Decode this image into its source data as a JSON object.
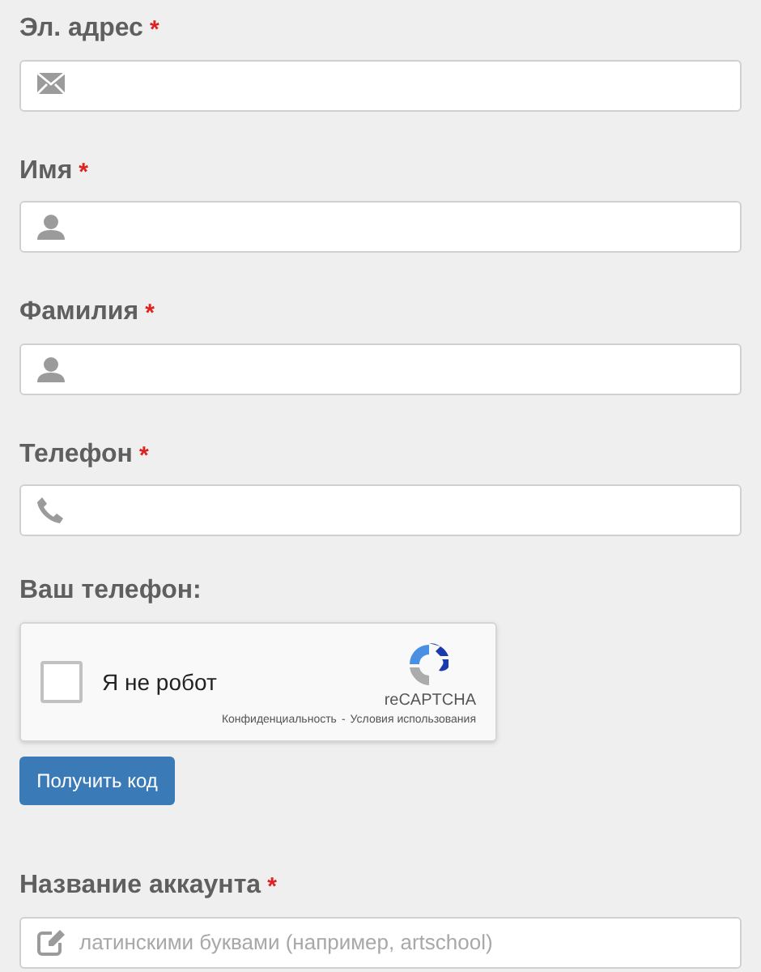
{
  "fields": [
    {
      "label": "Эл. адрес",
      "required_mark": "*",
      "kind": "mail"
    },
    {
      "label": "Имя",
      "required_mark": "*",
      "kind": "user"
    },
    {
      "label": "Фамилия",
      "required_mark": "*",
      "kind": "user"
    },
    {
      "label": "Телефон",
      "required_mark": "*",
      "kind": "phone"
    }
  ],
  "phone_section": {
    "label": "Ваш телефон:",
    "captcha": {
      "checked": false,
      "label": "Я не робот",
      "brand": "reCAPTCHA",
      "privacy": "Конфиденциальность",
      "separator": "-",
      "terms": "Условия использования"
    },
    "button": "Получить код"
  },
  "account_field": {
    "label": "Название аккаунта",
    "required_mark": "*",
    "kind": "edit",
    "placeholder": "латинскими буквами (например, artschool)"
  }
}
